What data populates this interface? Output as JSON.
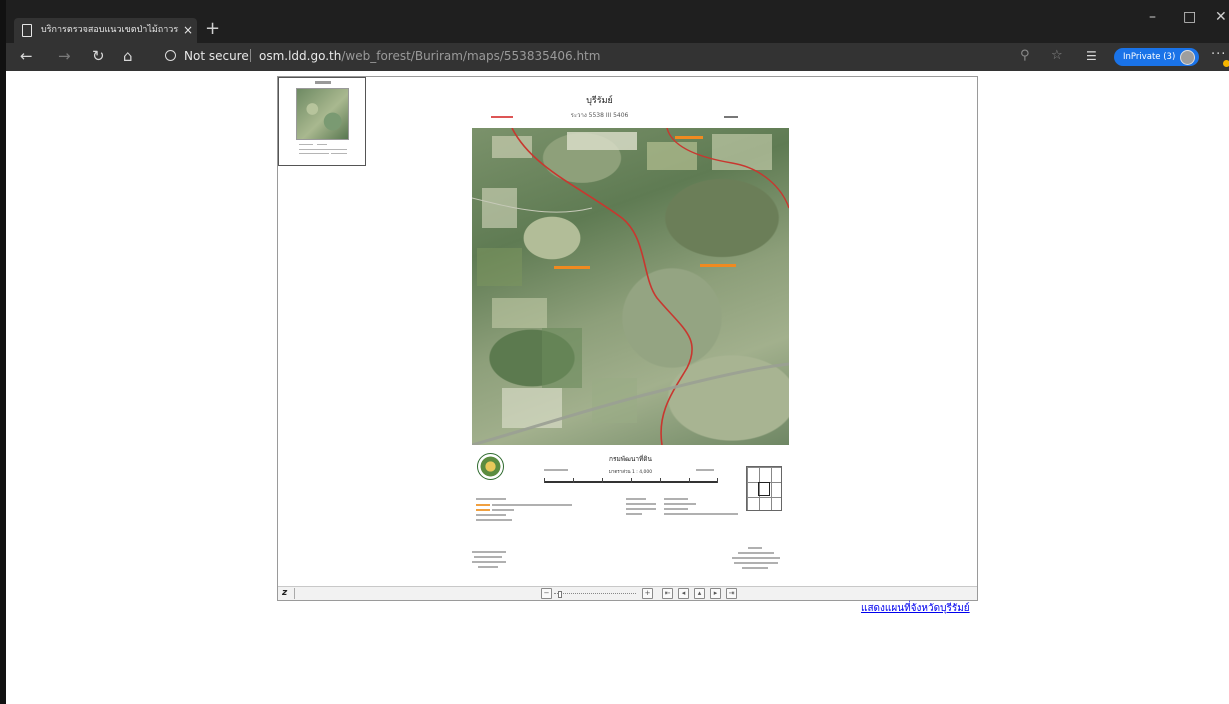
{
  "browser": {
    "tab_title": "บริการตรวจสอบแนวเขตป่าไม้ถาวรเนื่",
    "tab_close": "×",
    "new_tab": "+",
    "window": {
      "minimize": "–",
      "maximize": "□",
      "close": "✕"
    },
    "nav": {
      "back": "←",
      "forward": "→",
      "refresh": "↻",
      "home": "⌂"
    },
    "security_label": "Not secure",
    "url_host": "osm.ldd.go.th",
    "url_path": "/web_forest/Buriram/maps/553835406.htm",
    "icons": {
      "zoom": "⚲",
      "favorite": "☆",
      "favorites_list": "☰"
    },
    "inprivate_label": "InPrivate (3)",
    "more": "···"
  },
  "map_sheet": {
    "title": "บุรีรัมย์",
    "code": "ระวาง 5538 III 5406",
    "department": "กรมพัฒนาที่ดิน",
    "scale": "มาตราส่วน 1 : 4,000"
  },
  "viewer_controls": {
    "mode_button": "z",
    "zoom_out": "−",
    "zoom_in": "+",
    "zoom_level": 0.05,
    "nav_buttons": [
      "⇤",
      "◂",
      "▴",
      "▸",
      "⇥"
    ]
  },
  "province_link": "แสดงแผนที่จังหวัดบุรีรัมย์"
}
